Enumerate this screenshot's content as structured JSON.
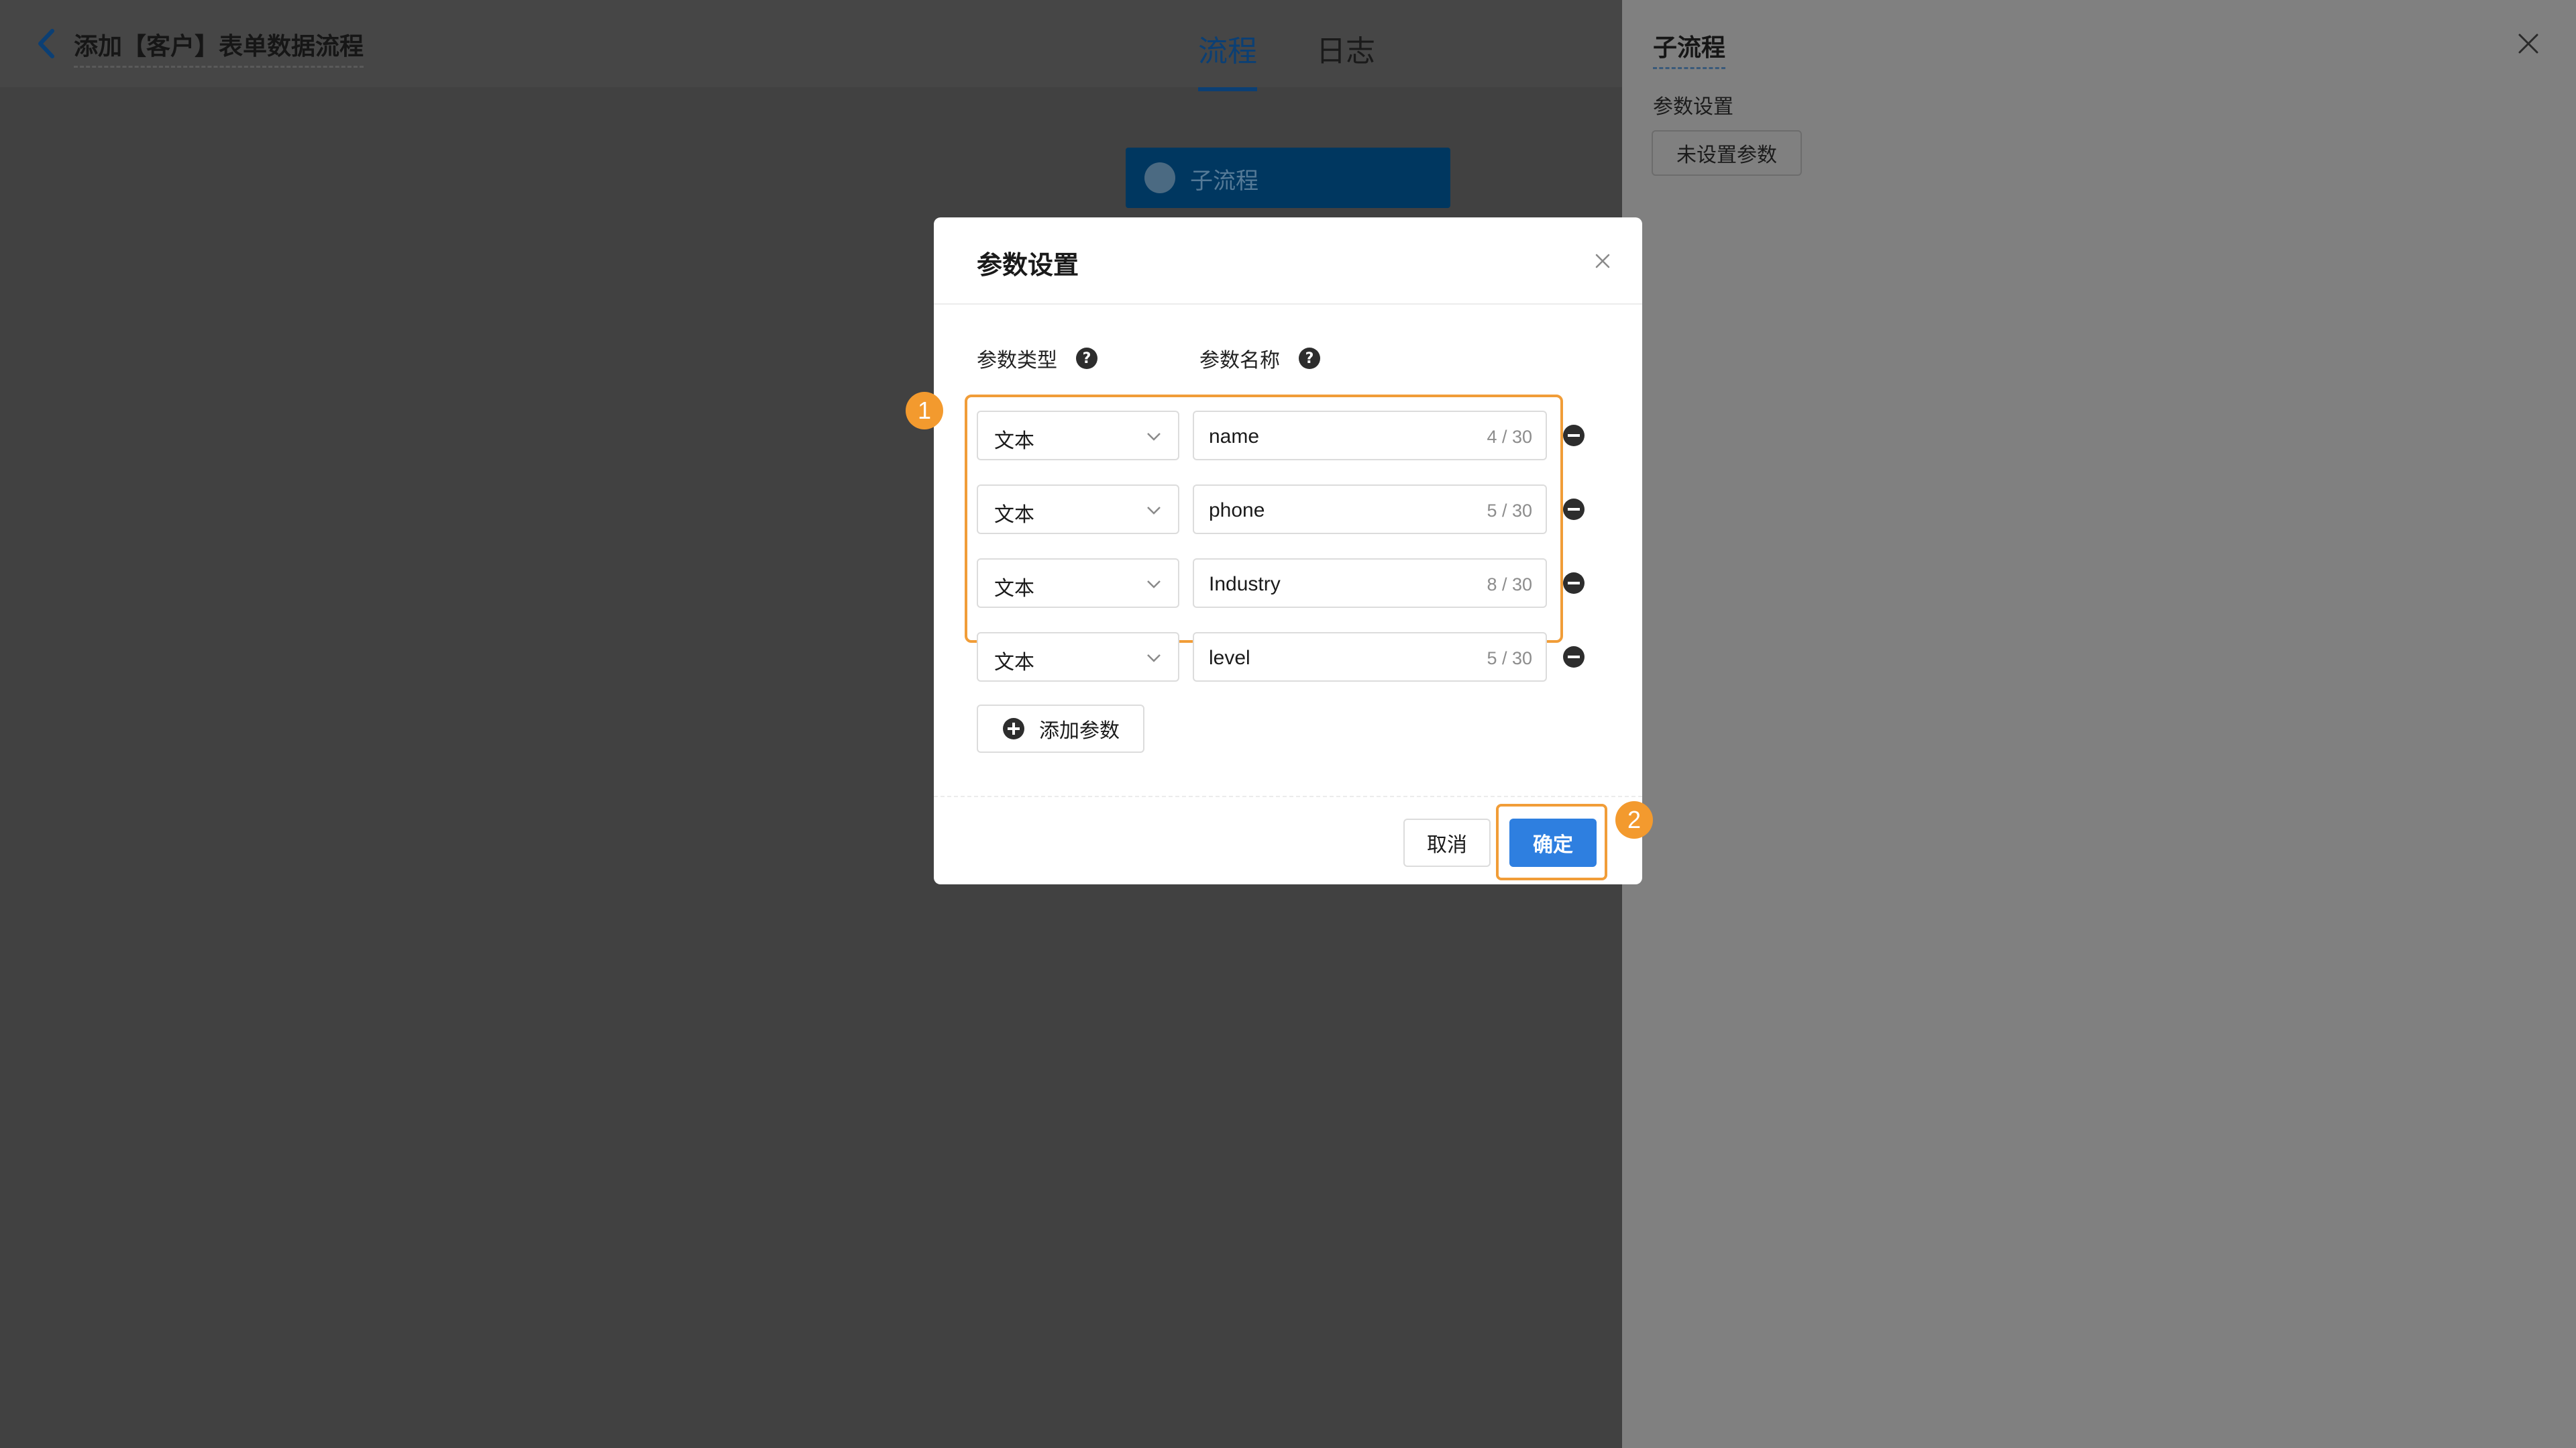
{
  "header": {
    "flow_title": "添加【客户】表单数据流程",
    "tabs": [
      {
        "label": "流程",
        "active": true
      },
      {
        "label": "日志",
        "active": false
      }
    ]
  },
  "canvas": {
    "node_label": "子流程"
  },
  "side_panel": {
    "title": "子流程",
    "section_label": "参数设置",
    "params_button": "未设置参数"
  },
  "modal": {
    "title": "参数设置",
    "column_type": "参数类型",
    "column_name": "参数名称",
    "help_glyph": "?",
    "rows": [
      {
        "type": "文本",
        "name": "name",
        "count": "4 / 30"
      },
      {
        "type": "文本",
        "name": "phone",
        "count": "5 / 30"
      },
      {
        "type": "文本",
        "name": "Industry",
        "count": "8 / 30"
      },
      {
        "type": "文本",
        "name": "level",
        "count": "5 / 30"
      }
    ],
    "add_button": "添加参数",
    "cancel_button": "取消",
    "confirm_button": "确定"
  },
  "annotations": {
    "badge_1": "1",
    "badge_2": "2"
  },
  "colors": {
    "accent": "#2e7fe0",
    "highlight": "#f19d38",
    "overlay_bg": "#414141"
  }
}
